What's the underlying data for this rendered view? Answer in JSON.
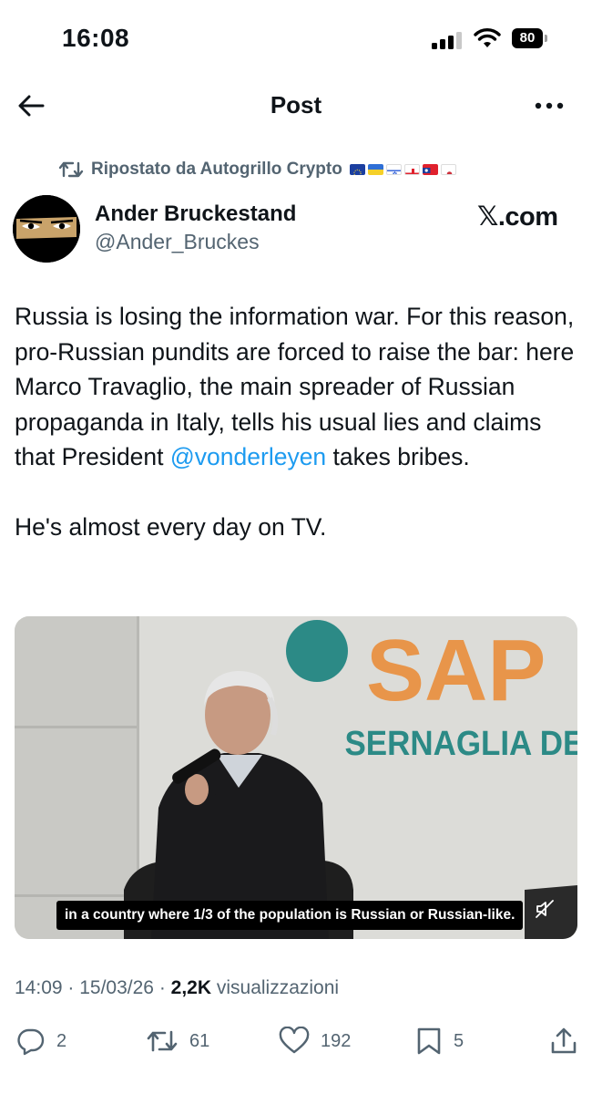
{
  "status_bar": {
    "time": "16:08",
    "battery": "80"
  },
  "header": {
    "title": "Post",
    "back_icon": "arrow-left-icon",
    "more_icon": "more-dots-icon"
  },
  "repost": {
    "icon": "repost-icon",
    "text": "Ripostato da Autogrillo Crypto",
    "flags": [
      "EU",
      "Ukraine",
      "Israel",
      "Georgia",
      "Taiwan",
      "South Korea"
    ]
  },
  "author": {
    "name": "Ander Bruckestand",
    "handle": "@Ander_Bruckes",
    "source_label": "𝕏.com"
  },
  "post": {
    "text_part1": "Russia is losing the information war. For this reason, pro-Russian pundits are forced to raise the bar: here Marco Travaglio, the main spreader of Russian propaganda in Italy, tells his usual lies and claims that President ",
    "mention": "@vonderleyen",
    "text_part2": " takes bribes.",
    "text_part3": "He's almost every day on TV."
  },
  "media": {
    "backdrop_big_text": "SAP",
    "backdrop_sub_text": "SERNAGLIA DELLA",
    "caption": "in a country where 1/3 of the population is Russian or Russian-like.",
    "mute_icon": "muted-speaker-icon"
  },
  "meta": {
    "time": "14:09",
    "sep1": " · ",
    "date": "15/03/26",
    "sep2": " · ",
    "views_count": "2,2K",
    "views_label": " visualizzazioni"
  },
  "actions": {
    "replies": "2",
    "reposts": "61",
    "likes": "192",
    "bookmarks": "5"
  },
  "colors": {
    "accent": "#1d9bf0",
    "secondary_text": "#536471",
    "primary_text": "#0f1419",
    "backdrop_orange": "#e8954a",
    "backdrop_teal": "#2c8a86"
  }
}
